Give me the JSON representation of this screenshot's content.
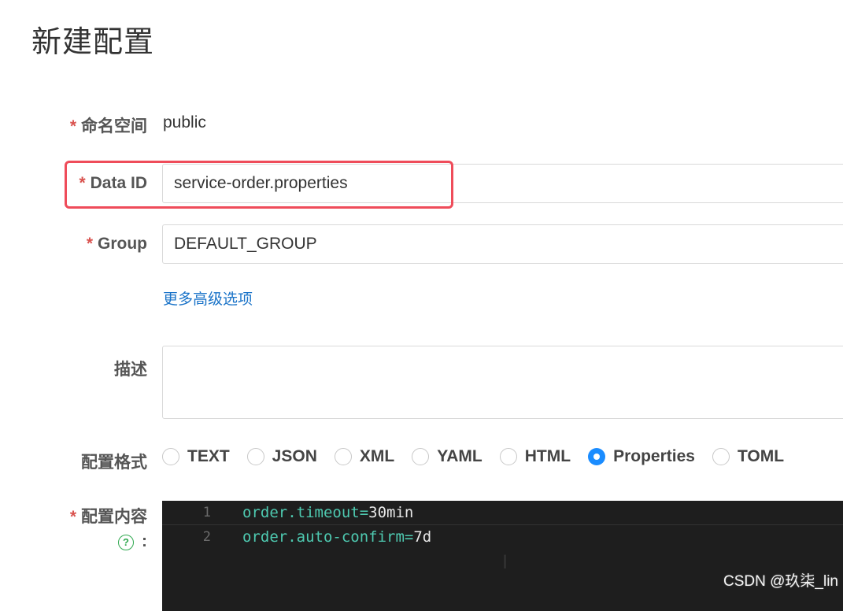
{
  "page": {
    "title": "新建配置"
  },
  "form": {
    "namespace": {
      "label": "命名空间",
      "value": "public"
    },
    "data_id": {
      "label": "Data ID",
      "value": "service-order.properties"
    },
    "group": {
      "label": "Group",
      "value": "DEFAULT_GROUP"
    },
    "advanced_link": "更多高级选项",
    "description": {
      "label": "描述",
      "value": ""
    },
    "format": {
      "label": "配置格式",
      "options": [
        "TEXT",
        "JSON",
        "XML",
        "YAML",
        "HTML",
        "Properties",
        "TOML"
      ],
      "selected": "Properties"
    },
    "content": {
      "label": "配置内容",
      "colon": ":",
      "help_glyph": "?",
      "lines": [
        {
          "num": "1",
          "key": "order.timeout",
          "eq": "=",
          "val": "30min"
        },
        {
          "num": "2",
          "key": "order.auto-confirm",
          "eq": "=",
          "val": "7d"
        }
      ]
    }
  },
  "required_mark": "*",
  "cursor_glyph": "I",
  "watermark": "CSDN @玖柒_lin",
  "colors": {
    "accent": "#1a8cff",
    "highlight_border": "#ef4c5a",
    "link": "#1a73c8",
    "editor_bg": "#1e1e1e",
    "code_key": "#4ec9b0"
  }
}
